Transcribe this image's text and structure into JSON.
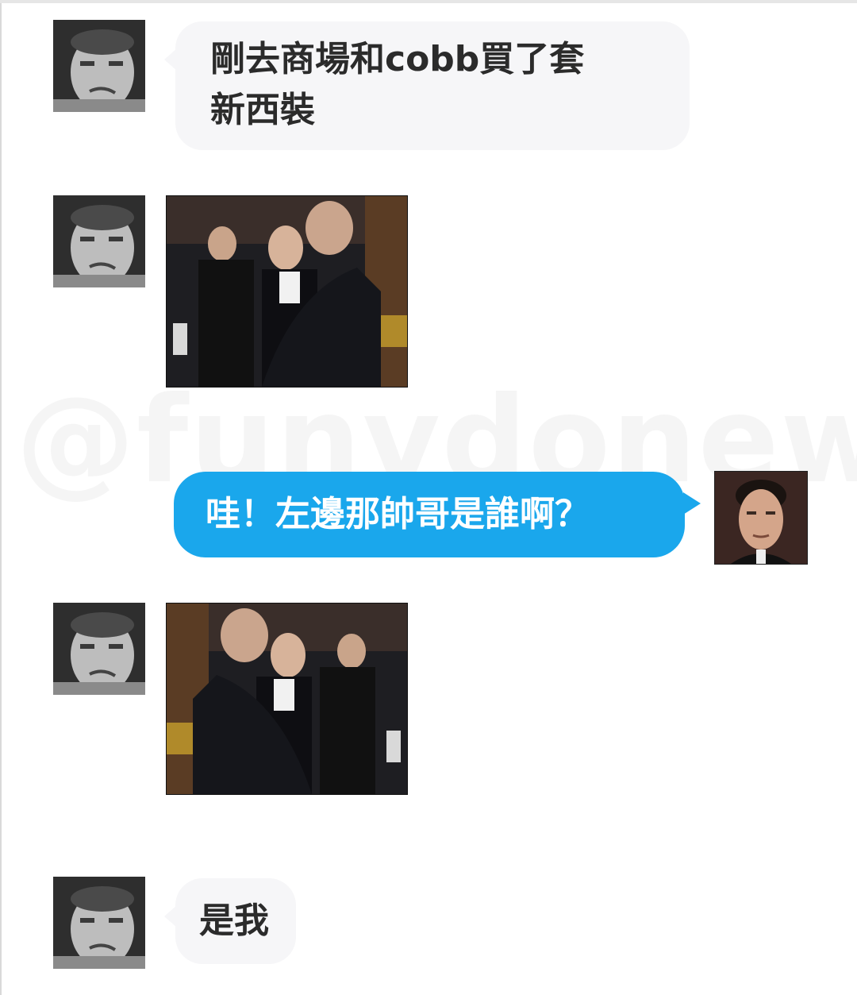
{
  "watermark": "@funvdonews",
  "messages": [
    {
      "side": "in",
      "type": "text",
      "text": "剛去商場和cobb買了套新西裝",
      "line1": "剛去商場和cobb買了套",
      "line2": "新西裝"
    },
    {
      "side": "in",
      "type": "image",
      "description_icon": "photo-two-men-hugging-suits"
    },
    {
      "side": "out",
      "type": "text",
      "text": "哇！左邊那帥哥是誰啊？"
    },
    {
      "side": "in",
      "type": "image",
      "description_icon": "photo-two-men-hugging-suits-mirrored"
    },
    {
      "side": "in",
      "type": "text",
      "text": "是我"
    }
  ],
  "colors": {
    "incoming_bubble": "#f6f6f8",
    "outgoing_bubble": "#1aa7ec",
    "outgoing_text": "#ffffff",
    "incoming_text": "#2b2b2b"
  }
}
